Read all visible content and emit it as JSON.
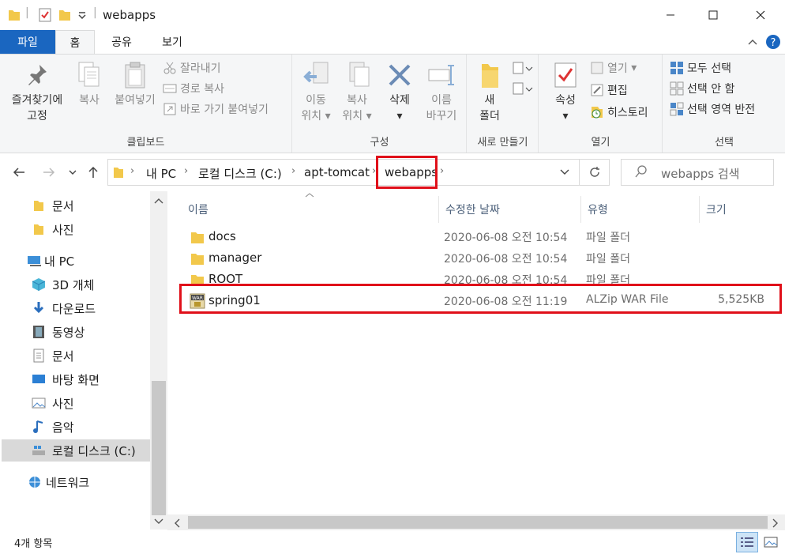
{
  "window": {
    "title": "webapps",
    "minimize": "─",
    "maximize": "☐",
    "close": "✕"
  },
  "ribbon_tabs": {
    "file": "파일",
    "home": "홈",
    "share": "공유",
    "view": "보기"
  },
  "ribbon": {
    "clipboard": {
      "label": "클립보드",
      "pin_line1": "즐겨찾기에",
      "pin_line2": "고정",
      "copy": "복사",
      "paste": "붙여넣기",
      "cut": "잘라내기",
      "copy_path": "경로 복사",
      "paste_shortcut": "바로 가기 붙여넣기"
    },
    "organize": {
      "label": "구성",
      "move_line1": "이동",
      "move_line2": "위치",
      "copy_line1": "복사",
      "copy_line2": "위치",
      "delete": "삭제",
      "rename_line1": "이름",
      "rename_line2": "바꾸기"
    },
    "new": {
      "label": "새로 만들기",
      "folder_line1": "새",
      "folder_line2": "폴더"
    },
    "open": {
      "label": "열기",
      "properties": "속성",
      "open": "열기",
      "edit": "편집",
      "history": "히스토리"
    },
    "select": {
      "label": "선택",
      "select_all": "모두 선택",
      "select_none": "선택 안 함",
      "invert": "선택 영역 반전"
    }
  },
  "address": {
    "crumbs": [
      "내 PC",
      "로컬 디스크 (C:)",
      "apt-tomcat",
      "webapps"
    ],
    "search_placeholder": "webapps 검색"
  },
  "nav_pane": {
    "items": [
      "문서",
      "사진",
      "내 PC",
      "3D 개체",
      "다운로드",
      "동영상",
      "문서",
      "바탕 화면",
      "사진",
      "음악",
      "로컬 디스크 (C:)",
      "네트워크"
    ]
  },
  "columns": {
    "name": "이름",
    "date": "수정한 날짜",
    "type": "유형",
    "size": "크기"
  },
  "files": [
    {
      "name": "docs",
      "date": "2020-06-08 오전 10:54",
      "type": "파일 폴더",
      "size": ""
    },
    {
      "name": "manager",
      "date": "2020-06-08 오전 10:54",
      "type": "파일 폴더",
      "size": ""
    },
    {
      "name": "ROOT",
      "date": "2020-06-08 오전 10:54",
      "type": "파일 폴더",
      "size": ""
    },
    {
      "name": "spring01",
      "date": "2020-06-08 오전 11:19",
      "type": "ALZip WAR File",
      "size": "5,525KB"
    }
  ],
  "status": {
    "count": "4개 항목"
  },
  "colors": {
    "accent": "#1a66c0",
    "highlight": "#e0101a",
    "folder": "#f2c84b"
  }
}
